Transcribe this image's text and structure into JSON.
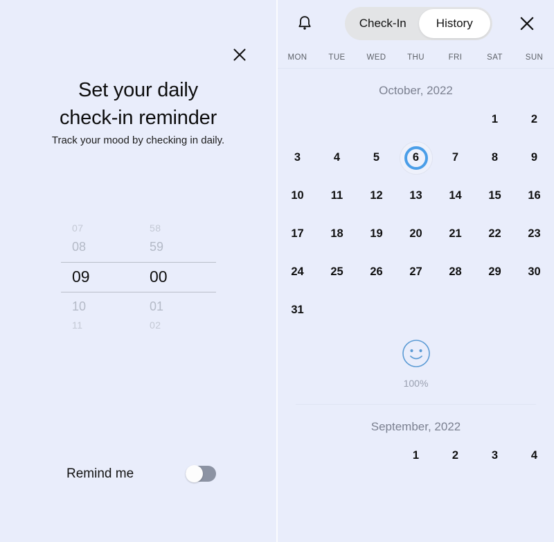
{
  "left": {
    "close_icon": "close-icon",
    "title_line1": "Set your daily",
    "title_line2": "check-in reminder",
    "subtitle": "Track your mood by checking in daily.",
    "timepicker": {
      "hours": {
        "far_above": "07",
        "near_above": "08",
        "selected": "09",
        "near_below": "10",
        "far_below": "11"
      },
      "minutes": {
        "far_above": "58",
        "near_above": "59",
        "selected": "00",
        "near_below": "01",
        "far_below": "02"
      }
    },
    "remind": {
      "label": "Remind me",
      "toggle_state": "off"
    }
  },
  "right": {
    "bell_icon": "bell-icon",
    "close_icon": "close-icon",
    "tabs": [
      {
        "label": "Check-In",
        "active": false
      },
      {
        "label": "History",
        "active": true
      }
    ],
    "weekdays": [
      "MON",
      "TUE",
      "WED",
      "THU",
      "FRI",
      "SAT",
      "SUN"
    ],
    "months": [
      {
        "label": "October, 2022",
        "leading_blanks": 5,
        "days": [
          1,
          2,
          3,
          4,
          5,
          6,
          7,
          8,
          9,
          10,
          11,
          12,
          13,
          14,
          15,
          16,
          17,
          18,
          19,
          20,
          21,
          22,
          23,
          24,
          25,
          26,
          27,
          28,
          29,
          30,
          31
        ],
        "selected_day": 6
      },
      {
        "label": "September, 2022",
        "leading_blanks": 3,
        "days": [
          1,
          2,
          3,
          4
        ],
        "selected_day": null
      }
    ],
    "mood": {
      "icon": "smiley-face-icon",
      "percent": "100%"
    },
    "colors": {
      "accent": "#4a9ee8",
      "background": "#e9edfb",
      "segment_track": "#e3e4e6",
      "toggle_track": "#8c93a3"
    }
  }
}
